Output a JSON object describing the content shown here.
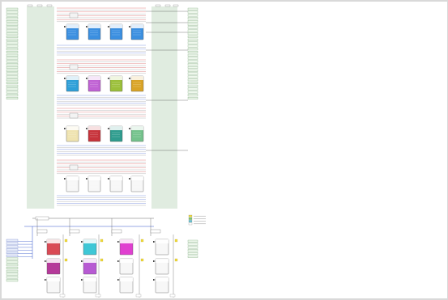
{
  "colors": {
    "background": "#d9d9d9",
    "canvas": "#ffffff",
    "bus_green": "#4a8f4a",
    "bus_blue": "#3355cc",
    "bus_red": "#cc3333",
    "bus_gray": "#888888",
    "legend_yellow": "#f2dc3a",
    "legend_green": "#7acc6a",
    "legend_cyan": "#5fc7d6"
  },
  "diagram": {
    "upper_block_rows": [
      {
        "name": "row-1",
        "blocks": [
          {
            "id": "u1-1",
            "color": "#3b8fe0"
          },
          {
            "id": "u1-2",
            "color": "#3b8fe0"
          },
          {
            "id": "u1-3",
            "color": "#3b8fe0"
          },
          {
            "id": "u1-4",
            "color": "#3b8fe0"
          }
        ]
      },
      {
        "name": "row-2",
        "blocks": [
          {
            "id": "u2-1",
            "color": "#2f9fd8"
          },
          {
            "id": "u2-2",
            "color": "#c062d4"
          },
          {
            "id": "u2-3",
            "color": "#9bbf3a"
          },
          {
            "id": "u2-4",
            "color": "#d9a326"
          }
        ]
      },
      {
        "name": "row-3",
        "blocks": [
          {
            "id": "u3-1",
            "color": "#efe3b0"
          },
          {
            "id": "u3-2",
            "color": "#c7333b"
          },
          {
            "id": "u3-3",
            "color": "#2f9c8e"
          },
          {
            "id": "u3-4",
            "color": "#74c28c"
          }
        ]
      },
      {
        "name": "row-4",
        "blocks": [
          {
            "id": "u4-1",
            "color": "#f7f7f7"
          },
          {
            "id": "u4-2",
            "color": "#f7f7f7"
          },
          {
            "id": "u4-3",
            "color": "#f7f7f7"
          },
          {
            "id": "u4-4",
            "color": "#f7f7f7"
          }
        ]
      }
    ],
    "lower_block_columns": [
      {
        "name": "col-1",
        "blocks": [
          {
            "id": "l1-1",
            "color": "#d94a55"
          },
          {
            "id": "l1-2",
            "color": "#b53a9a"
          },
          {
            "id": "l1-3",
            "color": "#f7f7f7"
          }
        ]
      },
      {
        "name": "col-2",
        "blocks": [
          {
            "id": "l2-1",
            "color": "#3ec7d6"
          },
          {
            "id": "l2-2",
            "color": "#b75ad3"
          },
          {
            "id": "l2-3",
            "color": "#f7f7f7"
          }
        ]
      },
      {
        "name": "col-3",
        "blocks": [
          {
            "id": "l3-1",
            "color": "#e040d0"
          },
          {
            "id": "l3-2",
            "color": "#f7f7f7"
          },
          {
            "id": "l3-3",
            "color": "#f7f7f7"
          }
        ]
      },
      {
        "name": "col-4",
        "blocks": [
          {
            "id": "l4-1",
            "color": "#f7f7f7"
          },
          {
            "id": "l4-2",
            "color": "#f7f7f7"
          },
          {
            "id": "l4-3",
            "color": "#f7f7f7"
          }
        ]
      }
    ],
    "legend": [
      {
        "color": "#f2dc3a",
        "label": ""
      },
      {
        "color": "#7acc6a",
        "label": ""
      },
      {
        "color": "#5fc7d6",
        "label": ""
      },
      {
        "color": "#ffffff",
        "label": ""
      }
    ]
  }
}
